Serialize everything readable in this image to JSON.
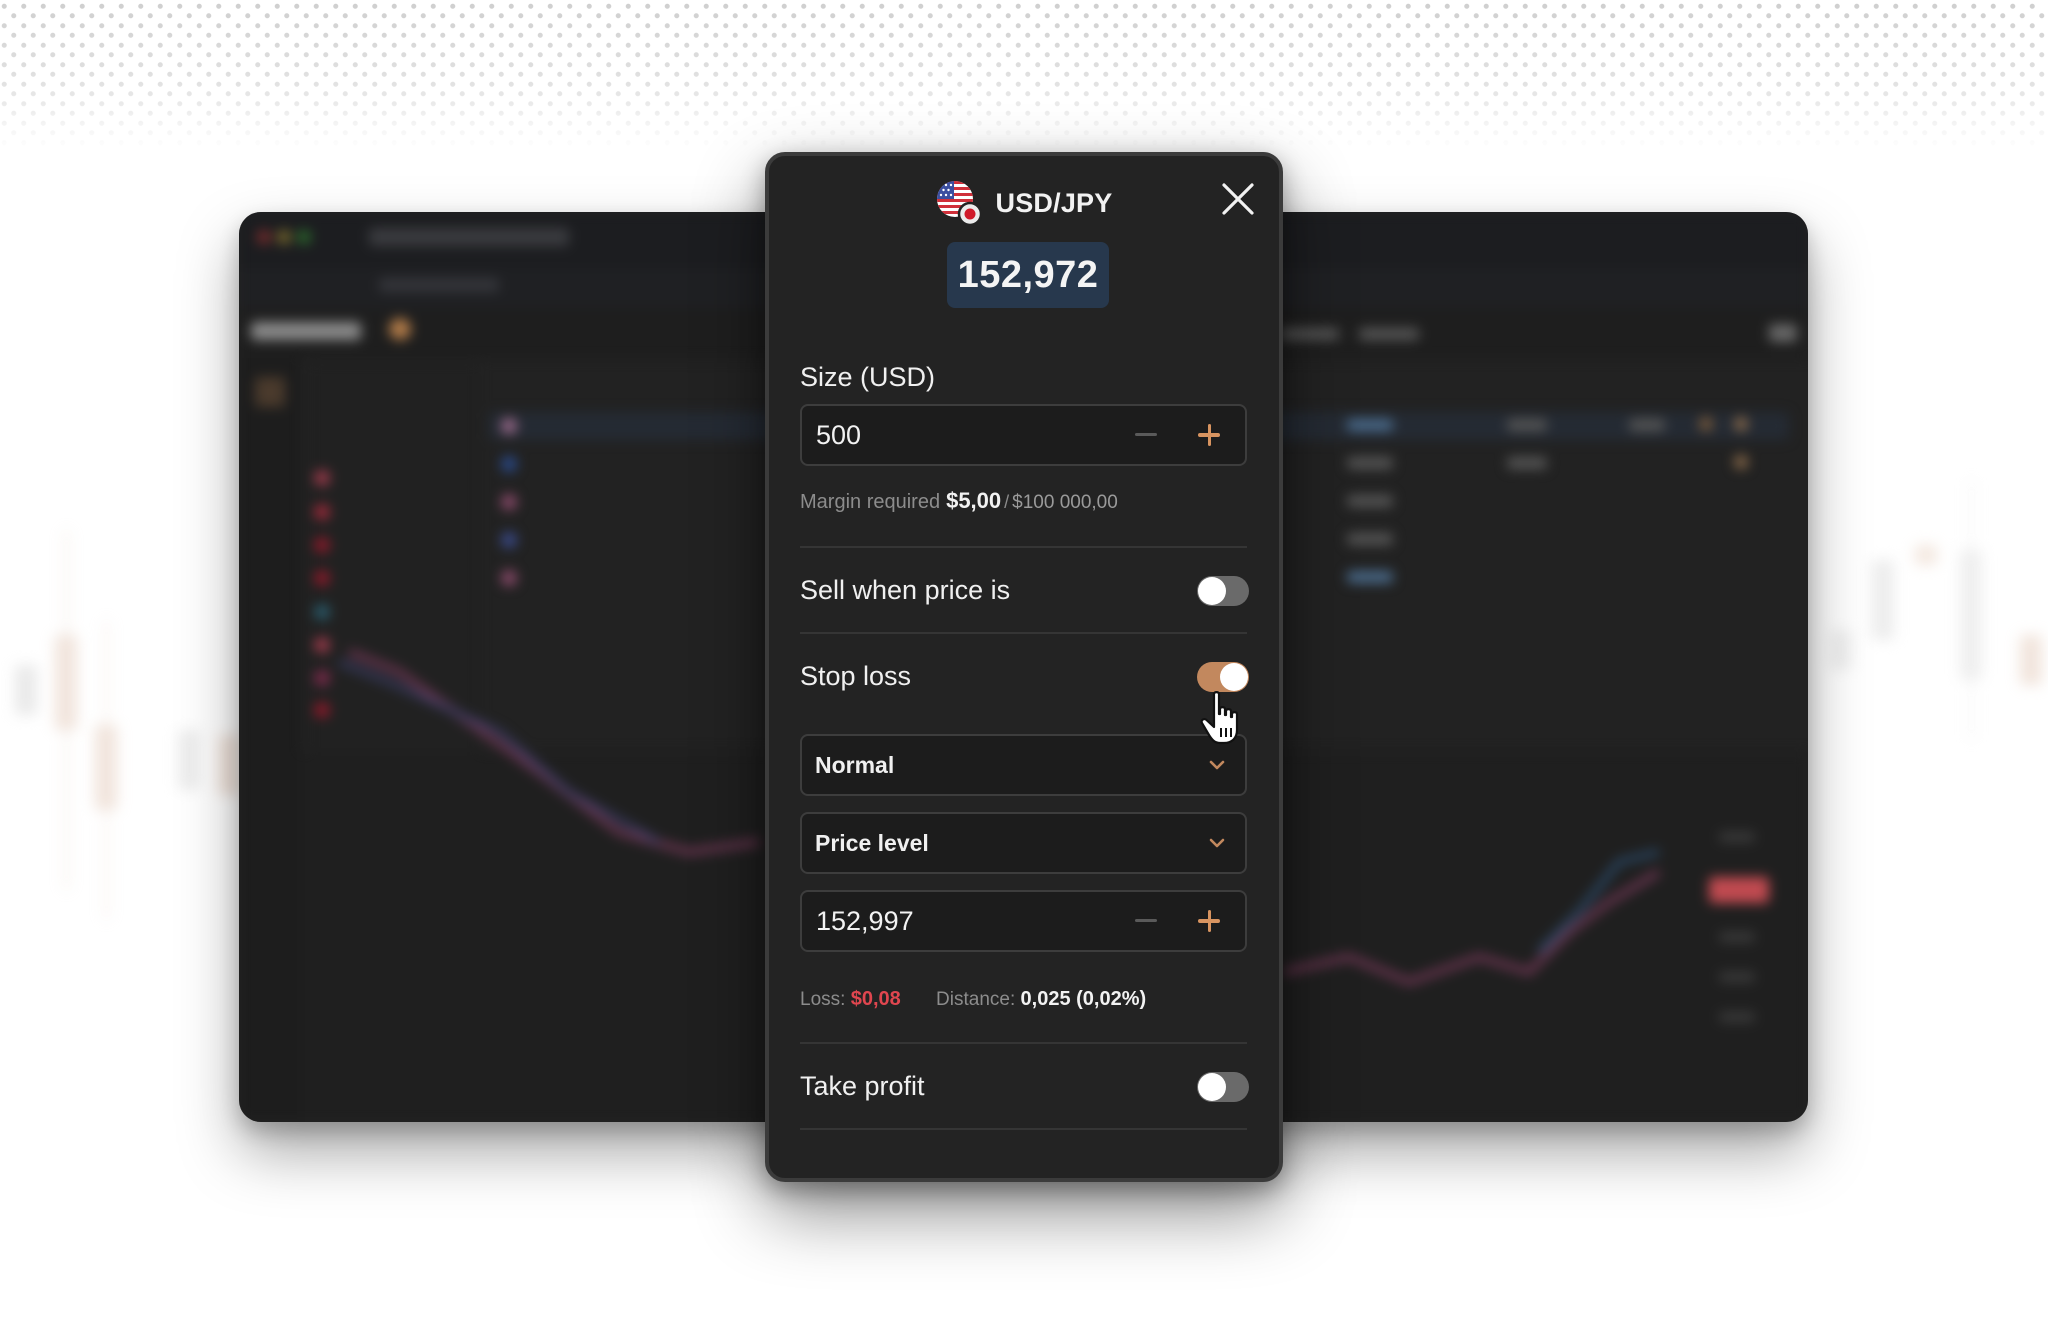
{
  "modal": {
    "pair": "USD/JPY",
    "pair_icon": "usd-jpy-flags-icon",
    "current_price": "152,972",
    "close_icon": "close-icon",
    "size": {
      "label": "Size (USD)",
      "value": "500",
      "minus_icon": "minus-icon",
      "plus_icon": "plus-icon"
    },
    "margin": {
      "label": "Margin required",
      "required": "$5,00",
      "separator": "/",
      "available": "$100 000,00"
    },
    "sell_when_price_is": {
      "label": "Sell when price is",
      "enabled": false
    },
    "stop_loss": {
      "label": "Stop loss",
      "enabled": true,
      "type_select": {
        "value": "Normal"
      },
      "mode_select": {
        "value": "Price level"
      },
      "price_value": "152,997",
      "loss_label": "Loss:",
      "loss_value": "$0,08",
      "distance_label": "Distance:",
      "distance_value": "0,025 (0,02%)"
    },
    "take_profit": {
      "label": "Take profit",
      "enabled": false
    }
  },
  "colors": {
    "accent": "#c2885e",
    "accent_plus": "#d89460",
    "loss_red": "#e0464f",
    "price_badge_bg": "#27384d",
    "modal_bg": "#232323"
  },
  "background_app": {
    "state": "blurred trading platform window"
  }
}
